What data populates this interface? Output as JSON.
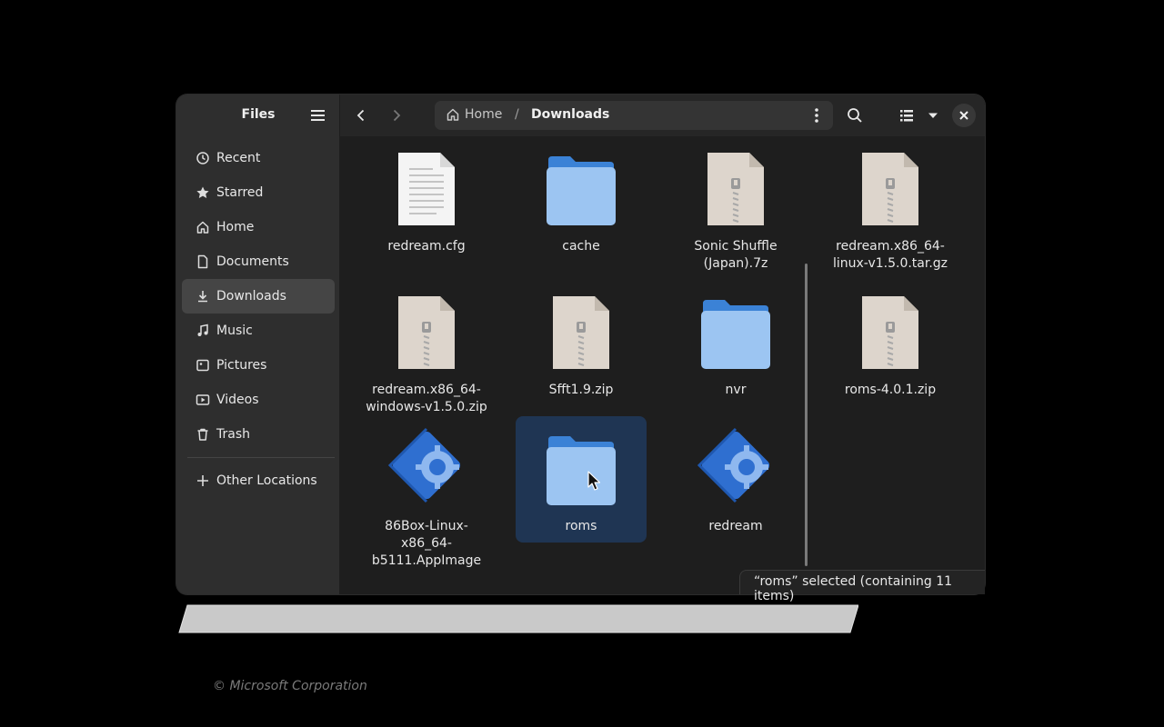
{
  "sidebar": {
    "title": "Files",
    "items": [
      {
        "label": "Recent",
        "icon": "clock-icon"
      },
      {
        "label": "Starred",
        "icon": "star-icon"
      },
      {
        "label": "Home",
        "icon": "home-icon"
      },
      {
        "label": "Documents",
        "icon": "document-icon"
      },
      {
        "label": "Downloads",
        "icon": "download-icon",
        "active": true
      },
      {
        "label": "Music",
        "icon": "music-icon"
      },
      {
        "label": "Pictures",
        "icon": "picture-icon"
      },
      {
        "label": "Videos",
        "icon": "video-icon"
      },
      {
        "label": "Trash",
        "icon": "trash-icon"
      }
    ],
    "other_locations": "Other Locations"
  },
  "pathbar": {
    "home": "Home",
    "separator": "/",
    "current": "Downloads"
  },
  "files": [
    {
      "name": "redream.cfg",
      "type": "text"
    },
    {
      "name": "cache",
      "type": "folder"
    },
    {
      "name": "Sonic Shuffle (Japan).7z",
      "type": "archive"
    },
    {
      "name": "redream.x86_64-linux-v1.5.0.tar.gz",
      "type": "archive"
    },
    {
      "name": "redream.x86_64-windows-v1.5.0.zip",
      "type": "archive"
    },
    {
      "name": "Sfft1.9.zip",
      "type": "archive"
    },
    {
      "name": "nvr",
      "type": "folder"
    },
    {
      "name": "roms-4.0.1.zip",
      "type": "archive"
    },
    {
      "name": "86Box-Linux-x86_64-b5111.AppImage",
      "type": "appimage"
    },
    {
      "name": "roms",
      "type": "folder",
      "selected": true
    },
    {
      "name": "redream",
      "type": "appimage"
    }
  ],
  "status": "“roms” selected  (containing 11 items)",
  "footer": {
    "copyright": "© Microsoft Corporation"
  },
  "colors": {
    "selection": "#1f3553",
    "folder": "#9cc5f2",
    "folder_tab": "#3b82d6"
  }
}
